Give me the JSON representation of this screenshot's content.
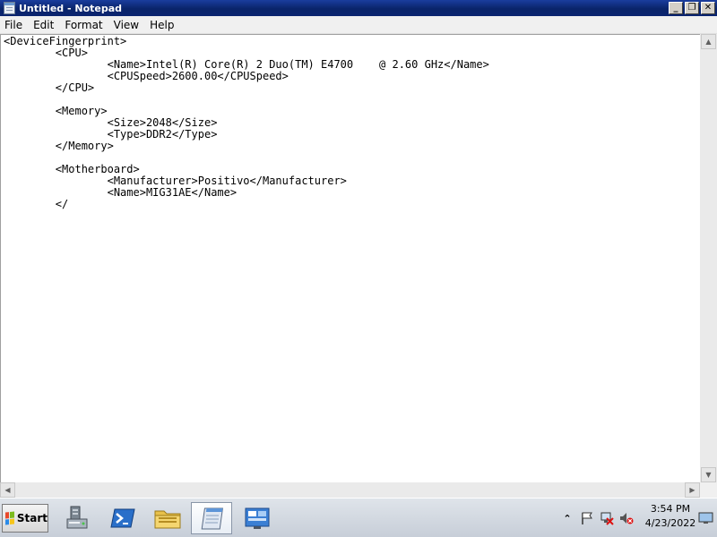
{
  "window": {
    "title": "Untitled - Notepad",
    "minimize_glyph": "_",
    "maximize_glyph": "❐",
    "close_glyph": "✕"
  },
  "menu": [
    {
      "label": "File"
    },
    {
      "label": "Edit"
    },
    {
      "label": "Format"
    },
    {
      "label": "View"
    },
    {
      "label": "Help"
    }
  ],
  "document": {
    "lines": [
      "<DeviceFingerprint>",
      "\t<CPU>",
      "\t\t<Name>Intel(R) Core(R) 2 Duo(TM) E4700    @ 2.60 GHz</Name>",
      "\t\t<CPUSpeed>2600.00</CPUSpeed>",
      "\t</CPU>",
      "",
      "\t<Memory>",
      "\t\t<Size>2048</Size>",
      "\t\t<Type>DDR2</Type>",
      "\t</Memory>",
      "",
      "\t<Motherboard>",
      "\t\t<Manufacturer>Positivo</Manufacturer>",
      "\t\t<Name>MIG31AE</Name>",
      "\t</"
    ]
  },
  "scrollbars": {
    "up_arrow": "▲",
    "down_arrow": "▼",
    "left_arrow": "◀",
    "right_arrow": "▶"
  },
  "taskbar": {
    "start_label": "Start",
    "pinned": [
      {
        "icon": "server-manager-icon"
      },
      {
        "icon": "powershell-icon"
      },
      {
        "icon": "explorer-folder-icon"
      },
      {
        "icon": "notepad-icon",
        "active": true
      },
      {
        "icon": "control-panel-icon"
      }
    ],
    "tray": {
      "overflow_glyph": "⌃",
      "icons": [
        "action-center-flag-icon",
        "network-icon",
        "volume-muted-icon"
      ],
      "time": "3:54 PM",
      "date": "4/23/2022"
    }
  },
  "colors": {
    "titlebar": "#0a246a",
    "menubar": "#f0f0f0",
    "taskbar": "#c7ced8"
  }
}
